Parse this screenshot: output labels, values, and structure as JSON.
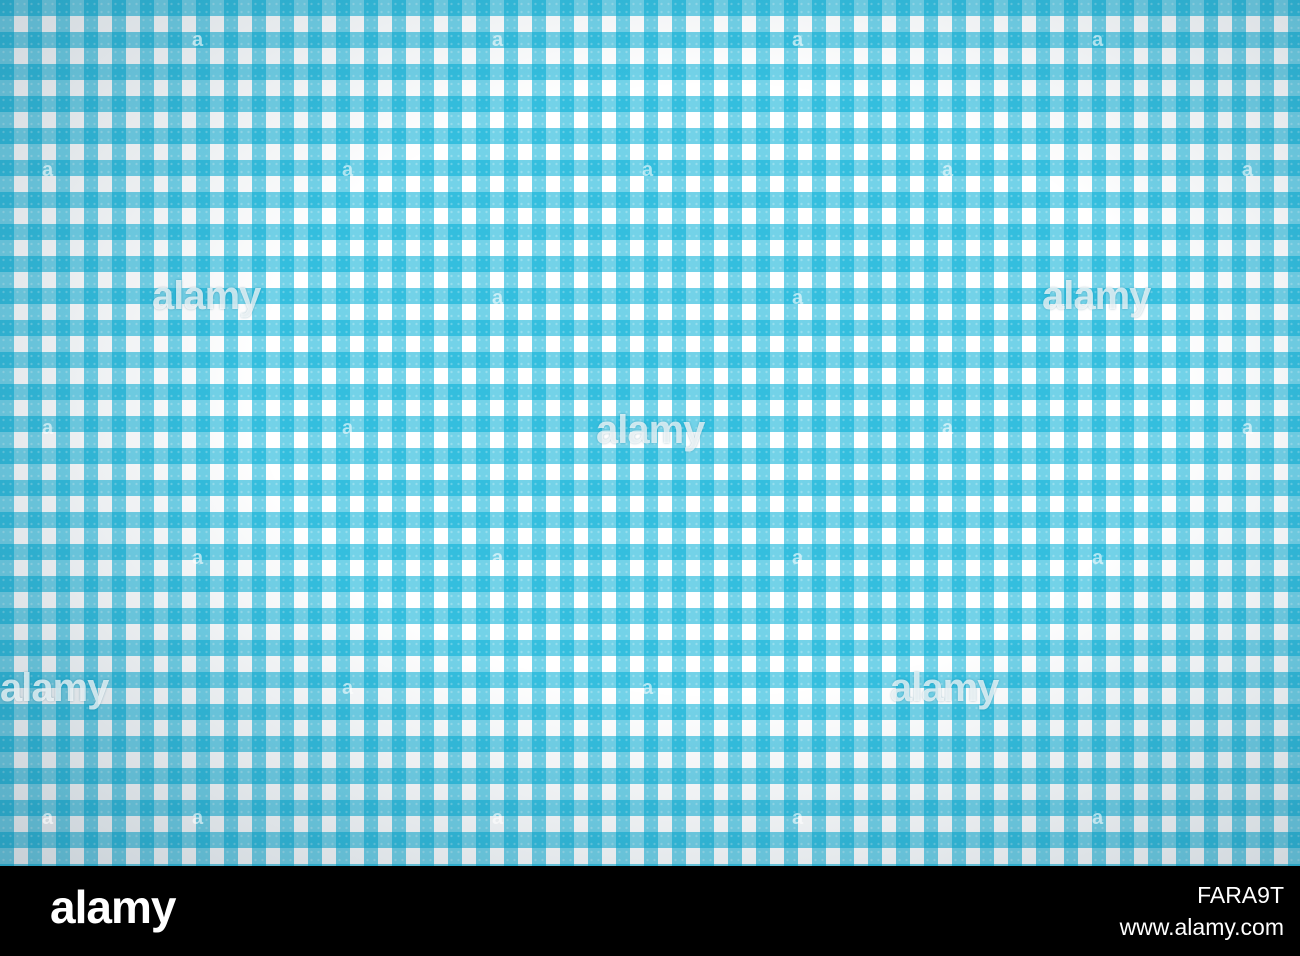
{
  "image": {
    "subject": "blue-and-white-gingham-fabric",
    "colors": {
      "check": "#00aed6",
      "background": "#ffffff",
      "footer": "#000000"
    }
  },
  "watermark": {
    "text": "alamy",
    "small_mark": "a"
  },
  "footer": {
    "logo": "alamy",
    "image_id": "FARA9T",
    "url": "www.alamy.com"
  }
}
